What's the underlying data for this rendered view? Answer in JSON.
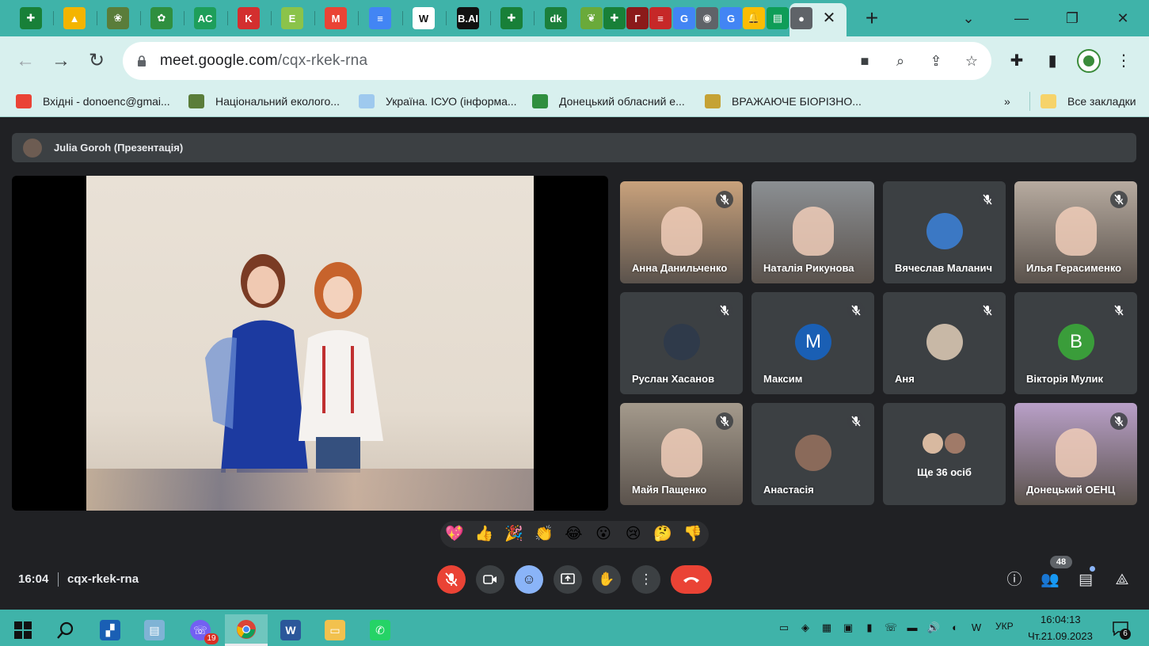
{
  "browser": {
    "tabs": [
      {
        "icon": "google-sheets-icon",
        "glyph": "✚",
        "color": "#188038"
      },
      {
        "icon": "google-drive-icon",
        "glyph": "▲",
        "color": "#f4b400"
      },
      {
        "icon": "ecology-site-icon",
        "glyph": "❀",
        "color": "#5a7d3a"
      },
      {
        "icon": "regional-center-icon",
        "glyph": "✿",
        "color": "#2f8f3f"
      },
      {
        "icon": "ac-icon",
        "glyph": "AC",
        "color": "#1e9e5a"
      },
      {
        "icon": "k-icon",
        "glyph": "K",
        "color": "#d32f2f"
      },
      {
        "icon": "e-icon",
        "glyph": "E",
        "color": "#8bc34a"
      },
      {
        "icon": "gmail-icon",
        "glyph": "M",
        "color": "#ea4335"
      },
      {
        "icon": "google-docs-icon",
        "glyph": "≡",
        "color": "#4285f4"
      },
      {
        "icon": "wikipedia-icon",
        "glyph": "W",
        "color": "#ffffff"
      },
      {
        "icon": "bai-icon",
        "glyph": "B.AI",
        "color": "#111111"
      },
      {
        "icon": "google-sheets-icon",
        "glyph": "✚",
        "color": "#188038"
      },
      {
        "icon": "dk-icon",
        "glyph": "dk",
        "color": "#1b7f3b"
      },
      {
        "icon": "leaf-icon",
        "glyph": "❦",
        "color": "#6aaa3a"
      },
      {
        "icon": "google-sheets-icon",
        "glyph": "✚",
        "color": "#188038"
      },
      {
        "icon": "g-red-icon",
        "glyph": "Г",
        "color": "#8b1a1a"
      },
      {
        "icon": "flag-icon",
        "glyph": "≡",
        "color": "#c62828"
      },
      {
        "icon": "google-icon",
        "glyph": "G",
        "color": "#4285f4"
      },
      {
        "icon": "chrome-icon",
        "glyph": "◉",
        "color": "#5f6368"
      },
      {
        "icon": "google-icon",
        "glyph": "G",
        "color": "#4285f4"
      },
      {
        "icon": "bell-icon",
        "glyph": "🔔",
        "color": "#fbbc04"
      },
      {
        "icon": "classroom-icon",
        "glyph": "▤",
        "color": "#0f9d58"
      },
      {
        "icon": "meet-icon",
        "glyph": "●",
        "color": "#5f6368"
      }
    ],
    "url_host": "meet.google.com",
    "url_path": "/cqx-rkek-rna",
    "bookmarks": [
      {
        "label": "Вхідні - donoenc@gmai...",
        "icon": "gmail-icon",
        "color": "#ea4335"
      },
      {
        "label": "Національний еколого...",
        "icon": "ecology-site-icon",
        "color": "#5a7d3a"
      },
      {
        "label": "Україна. ІСУО (інформа...",
        "icon": "isuo-icon",
        "color": "#9ec9ee"
      },
      {
        "label": "Донецький обласний е...",
        "icon": "regional-center-icon",
        "color": "#2f8f3f"
      },
      {
        "label": "ВРАЖАЮЧЕ БІОРІЗНО...",
        "icon": "biodiversity-icon",
        "color": "#c5a235"
      }
    ],
    "bookmarks_more": "»",
    "all_bookmarks": "Все закладки"
  },
  "meet": {
    "presenter_label": "Julia Goroh (Презентація)",
    "participants": [
      {
        "name": "Анна Данильченко",
        "kind": "video",
        "bg": "#c9a27c",
        "muted": true
      },
      {
        "name": "Наталія Рикунова",
        "kind": "video",
        "bg": "#8b8f93",
        "muted": false
      },
      {
        "name": "Вячеслав Маланич",
        "kind": "avatar",
        "avatar_color": "#3b78c4",
        "letter": "",
        "muted": true
      },
      {
        "name": "Илья Герасименко",
        "kind": "video",
        "bg": "#b7aba0",
        "muted": true
      },
      {
        "name": "Руслан Хасанов",
        "kind": "avatar",
        "avatar_color": "#2f3a4a",
        "letter": "",
        "muted": true
      },
      {
        "name": "Максим",
        "kind": "avatar",
        "avatar_color": "#1a5fb4",
        "letter": "M",
        "muted": true
      },
      {
        "name": "Аня",
        "kind": "avatar",
        "avatar_color": "#c8b8a6",
        "letter": "",
        "muted": true
      },
      {
        "name": "Вікторія Мулик",
        "kind": "avatar",
        "avatar_color": "#3a9d3a",
        "letter": "B",
        "muted": true
      },
      {
        "name": "Майя Пащенко",
        "kind": "video",
        "bg": "#a49a8c",
        "muted": true
      },
      {
        "name": "Анастасія",
        "kind": "avatar",
        "avatar_color": "#8a6a5a",
        "letter": "",
        "muted": true
      },
      {
        "name": "Ще 36 осіб",
        "kind": "more",
        "muted": false
      },
      {
        "name": "Донецький ОЕНЦ",
        "kind": "video",
        "bg": "#b9a0c8",
        "muted": true
      }
    ],
    "reactions": [
      "💖",
      "👍",
      "🎉",
      "👏",
      "😂",
      "😮",
      "😢",
      "🤔",
      "👎"
    ],
    "time": "16:04",
    "meeting_code": "cqx-rkek-rna",
    "participant_count": "48"
  },
  "taskbar": {
    "language": "УКР",
    "clock_time": "16:04:13",
    "clock_date": "Чт.21.09.2023",
    "viber_badge": "19",
    "notification_count": "6"
  }
}
